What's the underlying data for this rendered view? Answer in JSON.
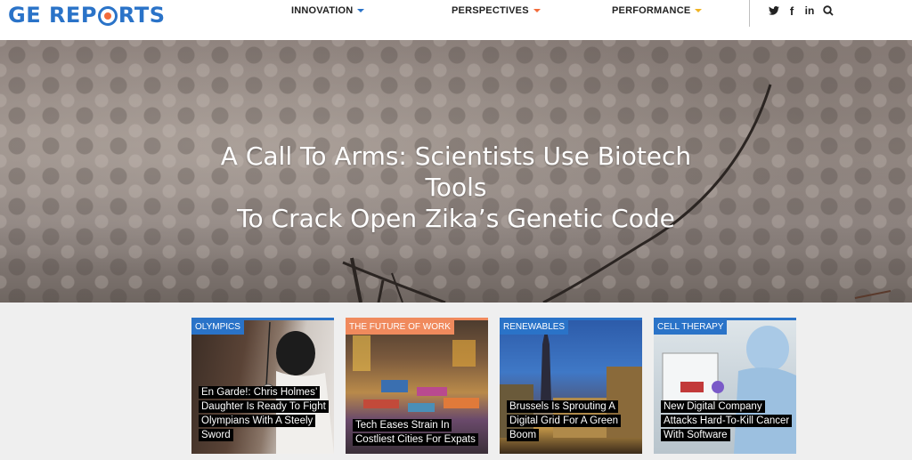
{
  "header": {
    "logo_text": [
      "GE REP",
      "RTS"
    ],
    "nav": [
      {
        "label": "INNOVATION",
        "accent": "#2a73c8"
      },
      {
        "label": "PERSPECTIVES",
        "accent": "#f26b3a"
      },
      {
        "label": "PERFORMANCE",
        "accent": "#f0b323"
      }
    ],
    "social_icons": [
      "twitter-icon",
      "facebook-icon",
      "linkedin-icon",
      "search-icon"
    ],
    "social_glyphs": [
      "🐦",
      "f",
      "in",
      "⌕"
    ]
  },
  "hero": {
    "title_line1": "A Call To Arms: Scientists Use Biotech Tools",
    "title_line2": "To Crack Open Zika’s Genetic Code"
  },
  "cards": [
    {
      "tag": "OLYMPICS",
      "tag_color": "#2a73c8",
      "title": "En Garde!: Chris Holmes’ Daughter Is Ready To Fight Olympians With A Steely Sword"
    },
    {
      "tag": "THE FUTURE OF WORK",
      "tag_color": "#f08a5d",
      "title": "Tech Eases Strain In Costliest Cities For Expats"
    },
    {
      "tag": "RENEWABLES",
      "tag_color": "#2a73c8",
      "title": "Brussels Is Sprouting A Digital Grid For A Green Boom"
    },
    {
      "tag": "CELL THERAPY",
      "tag_color": "#2a73c8",
      "title": "New Digital Company Attacks Hard-To-Kill Cancer With Software"
    }
  ]
}
